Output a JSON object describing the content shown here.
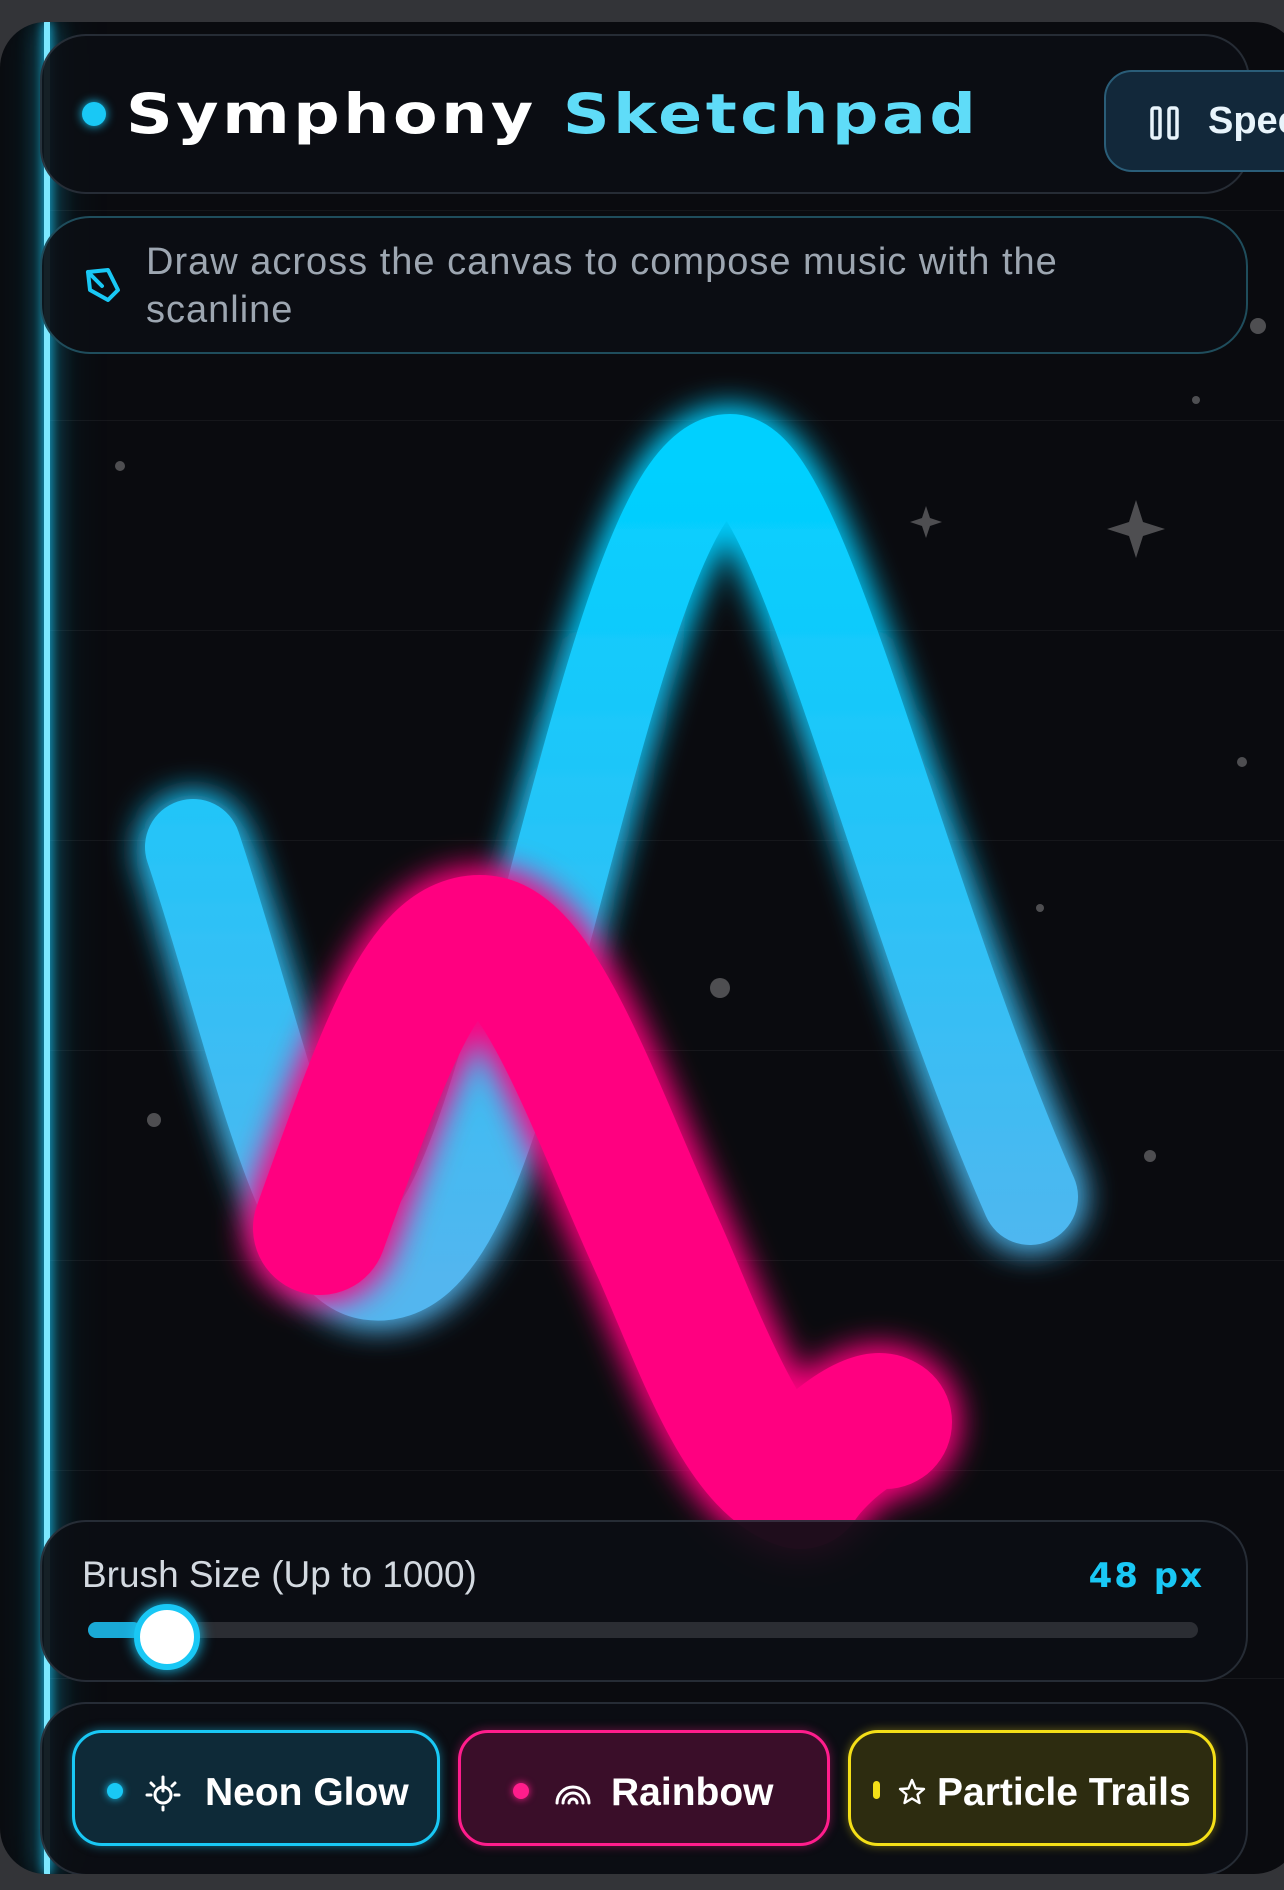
{
  "app": {
    "title_part1": "Symphony",
    "title_part2": "Sketchpad",
    "speed_label": "Speed:"
  },
  "hint": {
    "text": "Draw across the canvas to compose music with the scanline",
    "icon": "pen-tool-icon"
  },
  "canvas": {
    "strokes": [
      {
        "color": "#00d0ff",
        "name": "cyan"
      },
      {
        "color": "#ff0080",
        "name": "pink"
      }
    ]
  },
  "brush": {
    "label": "Brush Size (Up to 1000)",
    "value_label": "48 px",
    "value": 48,
    "max": 1000
  },
  "modes": [
    {
      "label": "Neon Glow",
      "icon": "sun-icon",
      "color": "#19c8f5"
    },
    {
      "label": "Rainbow",
      "icon": "rainbow-icon",
      "color": "#ff1d8c"
    },
    {
      "label": "Particle Trails",
      "icon": "star-icon",
      "color": "#f4df18"
    }
  ],
  "colors": {
    "accent": "#19c8f5",
    "background": "#0a0b0f"
  }
}
